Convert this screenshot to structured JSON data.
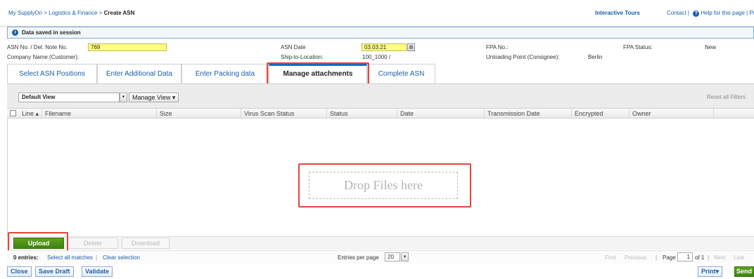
{
  "header": {
    "breadcrumb_links": "My SupplyOn > Logistics & Finance > ",
    "breadcrumb_current": "Create ASN",
    "interactive_tours": "Interactive Tours",
    "contact": "Contact |",
    "help": "Help for this page",
    "print_link": "| Print"
  },
  "message": {
    "text": "Data saved in session"
  },
  "asn": {
    "asn_no_label": "ASN No. / Del. Note No.",
    "asn_no_value": "769",
    "company_label": "Company Name (Customer):",
    "asn_date_label": "ASN Date",
    "asn_date_value": "03.03.21",
    "ship_to_label": "Ship-to-Location:",
    "ship_to_value": "100_1000 /",
    "fpa_no_label": "FPA No.:",
    "fpa_status_label": "FPA Status:",
    "fpa_status_value": "New",
    "unloading_label": "Unloading Point (Consignee):",
    "unloading_value": "Berlin"
  },
  "tabs": [
    {
      "label": "Select ASN Positions"
    },
    {
      "label": "Enter Additional Data"
    },
    {
      "label": "Enter Packing data"
    },
    {
      "label": "Manage attachments"
    },
    {
      "label": "Complete ASN"
    }
  ],
  "toolbar": {
    "view_value": "Default View",
    "manage_view": "Manage View",
    "reset_filters": "Reset all Filters"
  },
  "grid": {
    "columns": [
      "Line",
      "Filename",
      "Size",
      "Virus Scan Status",
      "Status",
      "Date",
      "Transmission Date",
      "Encrypted",
      "Owner"
    ]
  },
  "drop_zone": {
    "text": "Drop Files here"
  },
  "actions": {
    "upload": "Upload",
    "delete": "Delete",
    "download": "Download"
  },
  "pager": {
    "entries": "0 entries:",
    "select_all": "Select all matches",
    "clear_selection": "Clear selection",
    "entries_per_page_label": "Entries per page",
    "entries_per_page_value": "20",
    "first": "First",
    "previous": "Previous",
    "page_label": "Page",
    "page_value": "1",
    "of_pages": "of 1",
    "next": "Next",
    "last": "Last"
  },
  "footer": {
    "close": "Close",
    "save_draft": "Save Draft",
    "validate": "Validate",
    "print": "Print",
    "send": "Send"
  },
  "colors": {
    "link": "#1a5fa8",
    "input_highlight": "#ffff80",
    "primary_green": "#4a8f14",
    "callout_red": "#e8443a"
  }
}
